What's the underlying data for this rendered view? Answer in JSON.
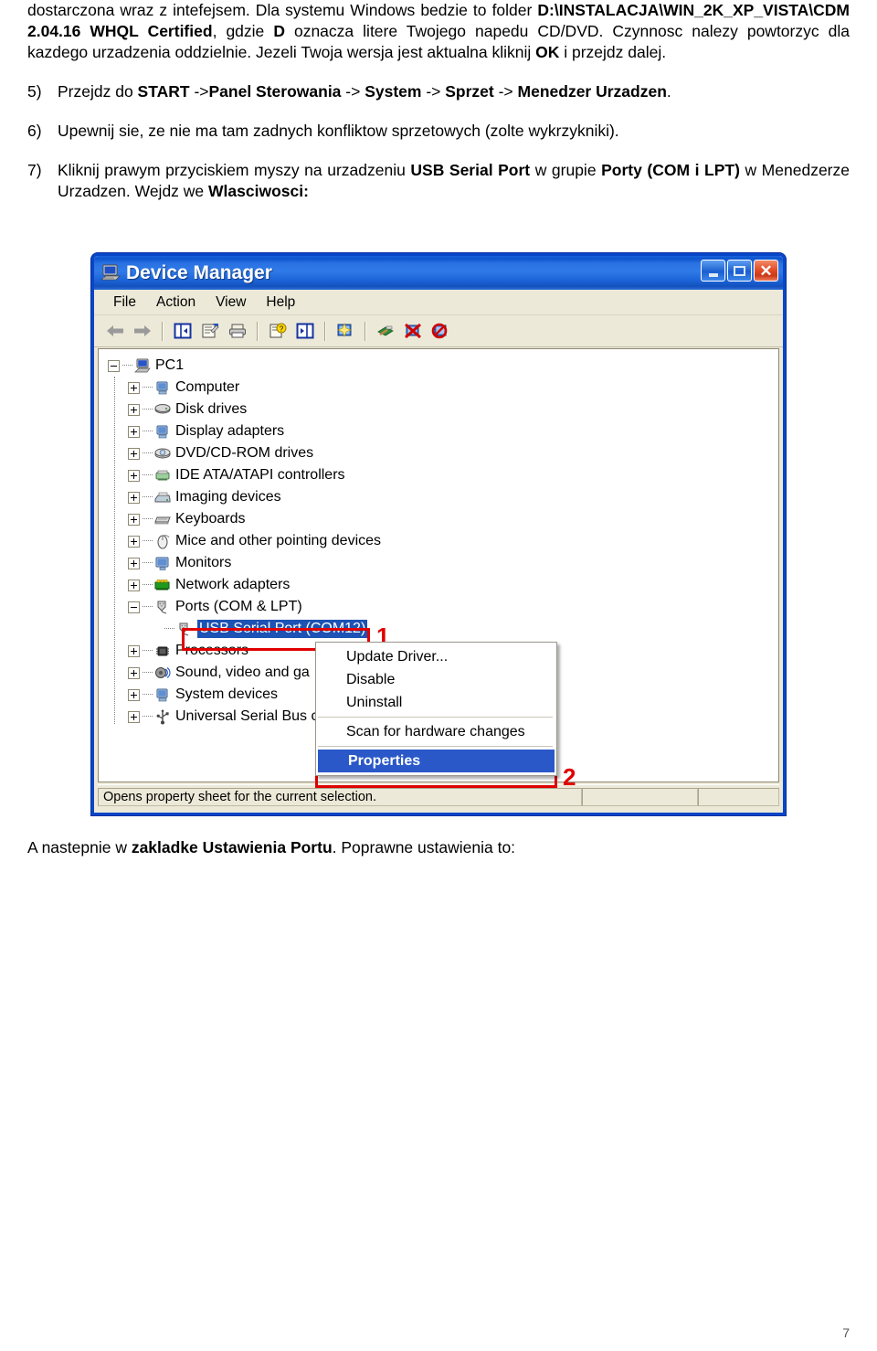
{
  "document": {
    "paragraph_intro": {
      "segments": [
        {
          "text": "dostarczona wraz z intefejsem. Dla systemu Windows bedzie to folder ",
          "bold": false
        },
        {
          "text": "D:\\INSTALACJA\\WIN_2K_XP_VISTA\\CDM 2.04.16 WHQL Certified",
          "bold": true
        },
        {
          "text": ", gdzie ",
          "bold": false
        },
        {
          "text": "D",
          "bold": true
        },
        {
          "text": " oznacza litere Twojego napedu CD/DVD. Czynnosc nalezy powtorzyc dla kazdego urzadzenia oddzielnie. Jezeli Twoja wersja jest aktualna kliknij ",
          "bold": false
        },
        {
          "text": "OK",
          "bold": true
        },
        {
          "text": " i przejdz dalej.",
          "bold": false
        }
      ]
    },
    "item5": {
      "marker": "5)",
      "segments": [
        {
          "text": "Przejdz do ",
          "bold": false
        },
        {
          "text": "START",
          "bold": true
        },
        {
          "text": " ->",
          "bold": false
        },
        {
          "text": "Panel Sterowania",
          "bold": true
        },
        {
          "text": "  -> ",
          "bold": false
        },
        {
          "text": "System",
          "bold": true
        },
        {
          "text": " -> ",
          "bold": false
        },
        {
          "text": "Sprzet",
          "bold": true
        },
        {
          "text": " -> ",
          "bold": false
        },
        {
          "text": "Menedzer Urzadzen",
          "bold": true
        },
        {
          "text": ".",
          "bold": false
        }
      ]
    },
    "item6": {
      "marker": "6)",
      "segments": [
        {
          "text": "Upewnij sie, ze nie ma tam zadnych konfliktow sprzetowych (zolte wykrzykniki).",
          "bold": false
        }
      ]
    },
    "item7": {
      "marker": "7)",
      "segments": [
        {
          "text": "Kliknij prawym przyciskiem myszy na urzadzeniu ",
          "bold": false
        },
        {
          "text": "USB Serial Port",
          "bold": true
        },
        {
          "text": " w grupie ",
          "bold": false
        },
        {
          "text": "Porty (COM i LPT)",
          "bold": true
        },
        {
          "text": " w Menedzerze Urzadzen. Wejdz we ",
          "bold": false
        },
        {
          "text": "Wlasciwosci:",
          "bold": true
        }
      ]
    },
    "closing": {
      "segments": [
        {
          "text": "A nastepnie w ",
          "bold": false
        },
        {
          "text": "zakladke Ustawienia Portu",
          "bold": true
        },
        {
          "text": ". Poprawne ustawienia to:",
          "bold": false
        }
      ]
    },
    "page_number": "7"
  },
  "device_manager": {
    "title": "Device Manager",
    "title_icon": "computer-icon",
    "window_buttons": {
      "minimize": "minimize-button",
      "maximize": "maximize-button",
      "close": "close-button"
    },
    "menu": [
      {
        "label": "File"
      },
      {
        "label": "Action"
      },
      {
        "label": "View"
      },
      {
        "label": "Help"
      }
    ],
    "toolbar": [
      {
        "name": "back-icon"
      },
      {
        "name": "forward-icon"
      },
      {
        "sep": true
      },
      {
        "name": "show-hide-console-tree-icon"
      },
      {
        "sep": false
      },
      {
        "name": "properties-icon"
      },
      {
        "name": "print-icon"
      },
      {
        "sep": true
      },
      {
        "name": "help-icon"
      },
      {
        "name": "show-hide-action-pane-icon"
      },
      {
        "sep": true
      },
      {
        "name": "scan-hardware-changes-icon"
      },
      {
        "sep": true
      },
      {
        "name": "update-driver-icon"
      },
      {
        "name": "uninstall-icon"
      },
      {
        "name": "disable-icon"
      }
    ],
    "tree": [
      {
        "label": "PC1",
        "level": 1,
        "state": "expanded",
        "icon": "computer-icon"
      },
      {
        "label": "Computer",
        "level": 2,
        "state": "collapsed",
        "icon": "computer-small-icon"
      },
      {
        "label": "Disk drives",
        "level": 2,
        "state": "collapsed",
        "icon": "disk-drive-icon"
      },
      {
        "label": "Display adapters",
        "level": 2,
        "state": "collapsed",
        "icon": "display-adapter-icon"
      },
      {
        "label": "DVD/CD-ROM drives",
        "level": 2,
        "state": "collapsed",
        "icon": "cdrom-icon"
      },
      {
        "label": "IDE ATA/ATAPI controllers",
        "level": 2,
        "state": "collapsed",
        "icon": "ide-controller-icon"
      },
      {
        "label": "Imaging devices",
        "level": 2,
        "state": "collapsed",
        "icon": "imaging-device-icon"
      },
      {
        "label": "Keyboards",
        "level": 2,
        "state": "collapsed",
        "icon": "keyboard-icon"
      },
      {
        "label": "Mice and other pointing devices",
        "level": 2,
        "state": "collapsed",
        "icon": "mouse-icon"
      },
      {
        "label": "Monitors",
        "level": 2,
        "state": "collapsed",
        "icon": "monitor-icon"
      },
      {
        "label": "Network adapters",
        "level": 2,
        "state": "collapsed",
        "icon": "network-adapter-icon"
      },
      {
        "label": "Ports (COM & LPT)",
        "level": 2,
        "state": "expanded",
        "icon": "port-icon"
      },
      {
        "label": "USB Serial Port (COM12)",
        "level": 3,
        "state": "leaf",
        "icon": "port-icon",
        "selected": true
      },
      {
        "label": "Processors",
        "level": 2,
        "state": "collapsed",
        "icon": "processor-icon"
      },
      {
        "label": "Sound, video and ga",
        "level": 2,
        "state": "collapsed",
        "icon": "sound-device-icon"
      },
      {
        "label": "System devices",
        "level": 2,
        "state": "collapsed",
        "icon": "system-device-icon"
      },
      {
        "label": "Universal Serial Bus c",
        "level": 2,
        "state": "collapsed",
        "icon": "usb-controller-icon"
      }
    ],
    "context_menu": [
      {
        "label": "Update Driver...",
        "highlight": false,
        "separator_after": false
      },
      {
        "label": "Disable",
        "highlight": false,
        "separator_after": false
      },
      {
        "label": "Uninstall",
        "highlight": false,
        "separator_after": true
      },
      {
        "label": "Scan for hardware changes",
        "highlight": false,
        "separator_after": true
      },
      {
        "label": "Properties",
        "highlight": true,
        "separator_after": false
      }
    ],
    "status_bar": {
      "message": "Opens property sheet for the current selection.",
      "pane2": "",
      "pane3": ""
    },
    "annotations": [
      {
        "number": "1",
        "target": "usb-serial-port-row"
      },
      {
        "number": "2",
        "target": "properties-menu-item"
      }
    ],
    "colors": {
      "title_bar": "#1763dc",
      "window_border": "#0a46c8",
      "chrome": "#ece9d8",
      "selection": "#1c53b4",
      "annotation": "#e00000",
      "menu_highlight": "#2a58c8"
    }
  }
}
